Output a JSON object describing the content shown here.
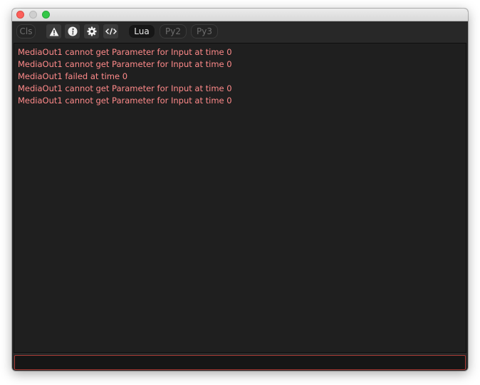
{
  "window": {
    "title": ""
  },
  "toolbar": {
    "cls_label": "Cls",
    "buttons": [
      {
        "icon": "warning-icon"
      },
      {
        "icon": "info-icon"
      },
      {
        "icon": "gear-icon"
      },
      {
        "icon": "code-icon"
      }
    ],
    "languages": [
      {
        "label": "Lua",
        "active": true
      },
      {
        "label": "Py2",
        "active": false
      },
      {
        "label": "Py3",
        "active": false
      }
    ]
  },
  "console": {
    "lines": [
      "MediaOut1 cannot get Parameter for Input at time 0",
      "MediaOut1 cannot get Parameter for Input at time 0",
      "MediaOut1 failed at time 0",
      "MediaOut1 cannot get Parameter for Input at time 0",
      "MediaOut1 cannot get Parameter for Input at time 0"
    ],
    "error_color": "#ff8a8a"
  },
  "input": {
    "value": "",
    "placeholder": ""
  }
}
